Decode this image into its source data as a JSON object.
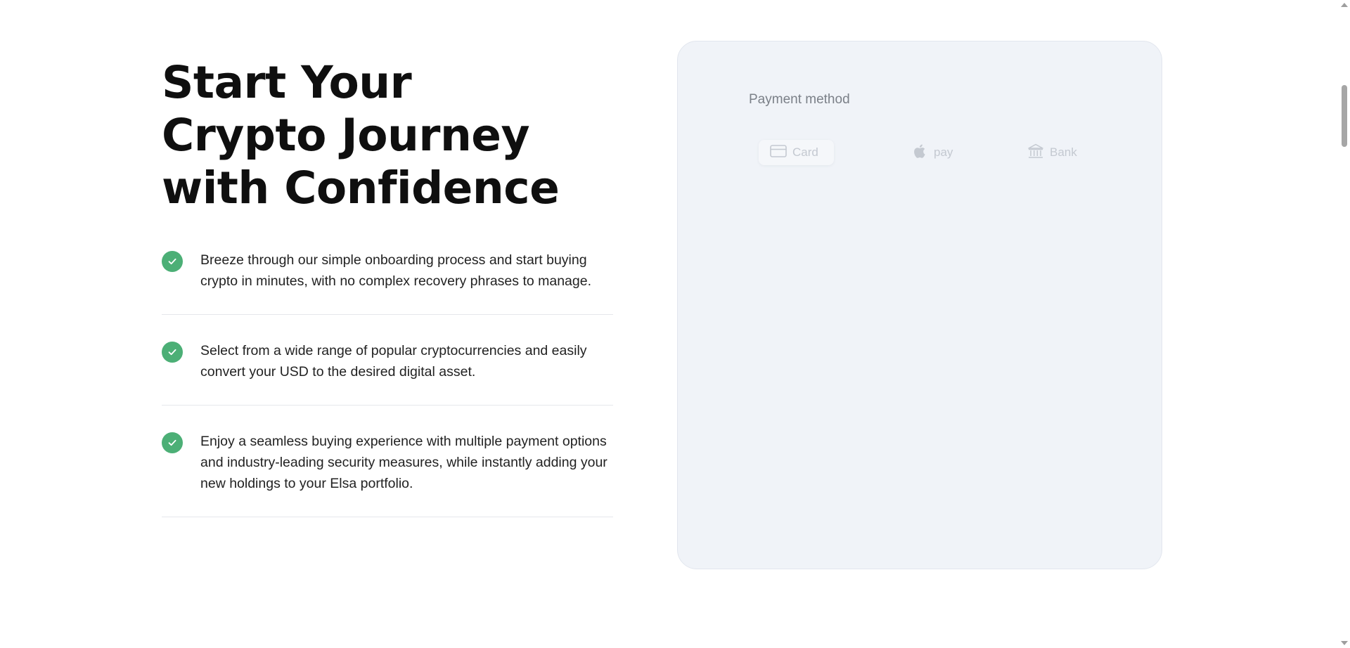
{
  "hero": {
    "title": "Start Your Crypto Journey with Confidence"
  },
  "features": [
    {
      "text": "Breeze through our simple onboarding process and start buying crypto in minutes, with no complex recovery phrases to manage."
    },
    {
      "text": "Select from a wide range of popular cryptocurrencies and easily convert your USD to the desired digital asset."
    },
    {
      "text": "Enjoy a seamless buying experience with multiple payment options and industry-leading security measures, while instantly adding your new holdings to your Elsa portfolio."
    }
  ],
  "payment": {
    "label": "Payment method",
    "options": [
      {
        "label": "Card",
        "icon": "credit-card-icon",
        "selected": true
      },
      {
        "label": "pay",
        "icon": "apple-icon",
        "selected": false
      },
      {
        "label": "Bank",
        "icon": "bank-icon",
        "selected": false
      }
    ]
  },
  "colors": {
    "check_green": "#4caf76",
    "panel_bg": "#f0f3f8",
    "muted_text": "#c4c9d1"
  },
  "icons": {
    "feature_check": "check-circle-icon"
  }
}
